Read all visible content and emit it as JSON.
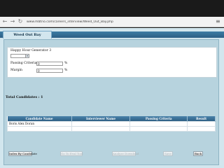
{
  "browser": {
    "url": "www.mbtrio.com/careers_interview/Weed_Out_Bay.php"
  },
  "tab": {
    "label": "Weed Out Bay"
  },
  "form": {
    "heading": "Happy Hour Generator 3",
    "passing_criteria_label": "Passing Criteria",
    "passing_criteria_value": "0",
    "margin_label": "Margin",
    "margin_value": "0",
    "percent_symbol": "%"
  },
  "total": {
    "label": "Total Candidates :",
    "value": "1"
  },
  "table": {
    "headers": [
      "Candidate Name",
      "Interviewer Name",
      "Passing Criteria",
      "Result"
    ],
    "rows": [
      [
        "Boris Alex Doran",
        "",
        "",
        ""
      ],
      [
        "",
        "",
        "",
        ""
      ]
    ]
  },
  "buttons": {
    "index_by_candidate": "Index By Candidate",
    "go_to_eval_tool": "Go To Eval Tool",
    "analyze_download": "Analyze Download",
    "save": "Save",
    "back": "Back"
  },
  "colors": {
    "page_bg": "#d2e6ee",
    "panel_bg": "#b7d3de",
    "header_blue": "#2d5f84"
  }
}
